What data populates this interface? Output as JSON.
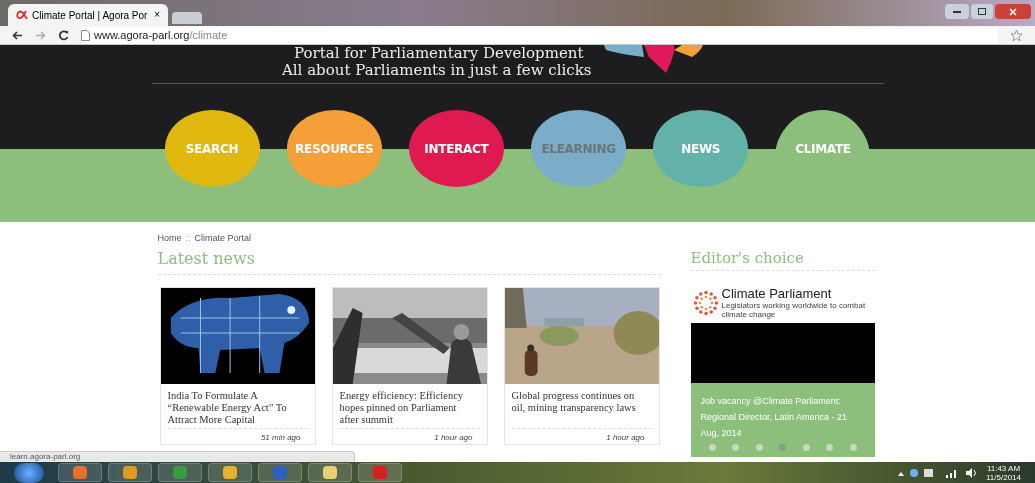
{
  "browser": {
    "tab_title": "Climate Portal | Agora Por",
    "tab_close": "×",
    "url_host": "www.agora-parl.org",
    "url_path": "/climate"
  },
  "header": {
    "line1": "Portal for Parliamentary Development",
    "line2": "All about Parliaments in just a few clicks"
  },
  "nav": [
    {
      "label": "SEARCH",
      "color": "#e0b80f",
      "selected": false,
      "muted": false
    },
    {
      "label": "RESOURCES",
      "color": "#f59f38",
      "selected": false,
      "muted": false
    },
    {
      "label": "INTERACT",
      "color": "#df1a50",
      "selected": false,
      "muted": false
    },
    {
      "label": "ELEARNING",
      "color": "#7aaec8",
      "selected": false,
      "muted": true
    },
    {
      "label": "NEWS",
      "color": "#63b2a9",
      "selected": false,
      "muted": false
    },
    {
      "label": "CLIMATE",
      "color": "#8cbf7c",
      "selected": true,
      "muted": false
    }
  ],
  "breadcrumb": [
    "Home",
    "::",
    "Climate Portal"
  ],
  "latest_news": {
    "title": "Latest news",
    "items": [
      {
        "kind": "solar",
        "headline": "India To Formulate A “Renewable Energy Act” To Attract More Capital",
        "time": "51 min ago"
      },
      {
        "kind": "assembly",
        "headline": "Energy efficiency: Efficiency hopes pinned on Parliament after summit",
        "time": "1 hour ago"
      },
      {
        "kind": "landscape",
        "headline": "Global progress continues on oil, mining transparency laws",
        "time": "1 hour ago"
      }
    ]
  },
  "editors_choice": {
    "title": "Editor's choice",
    "logo_name": "Climate Parliament",
    "logo_tagline": "Legislators working worldwide to combat climate change",
    "caption": "Job vacancy @Climate Parliament: Regional Director, Latin America - 21 Aug, 2014",
    "dots": [
      {
        "selected": false
      },
      {
        "selected": false
      },
      {
        "selected": false
      },
      {
        "selected": true
      },
      {
        "selected": false
      },
      {
        "selected": false
      },
      {
        "selected": false
      }
    ]
  },
  "status_bubble": "learn.agora-parl.org",
  "taskbar": {
    "time": "11:43 AM",
    "date": "11/5/2014"
  }
}
